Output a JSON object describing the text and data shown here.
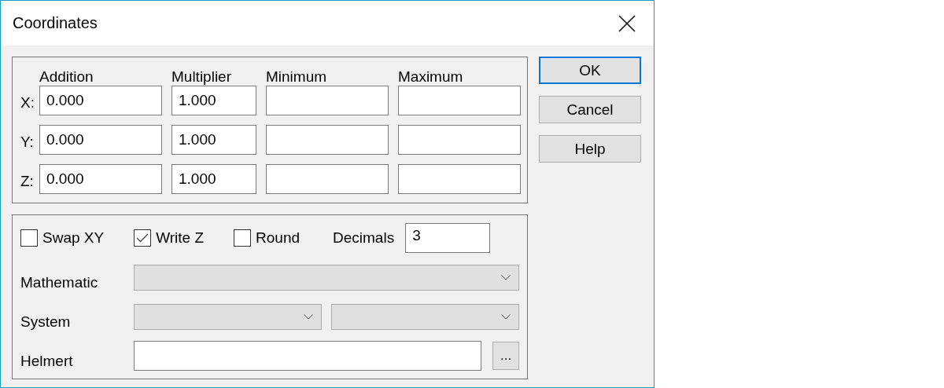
{
  "window": {
    "title": "Coordinates"
  },
  "coordinates": {
    "columns": [
      "Addition",
      "Multiplier",
      "Minimum",
      "Maximum"
    ],
    "rows": [
      {
        "label": "X:",
        "values": [
          "0.000",
          "1.000"
        ]
      },
      {
        "label": "Y:",
        "values": [
          "0.000",
          "1.000"
        ]
      },
      {
        "label": "Z:",
        "values": [
          "0.000",
          "1.000"
        ]
      }
    ]
  },
  "options": {
    "checkboxes": [
      {
        "label": "Swap XY",
        "checked": false
      },
      {
        "label": "Write Z",
        "checked": true
      },
      {
        "label": "Round",
        "checked": false
      }
    ],
    "decimals": {
      "label": "Decimals",
      "value": "3"
    },
    "mathematic": {
      "label": "Mathematic",
      "disabled": true
    },
    "system": {
      "label": "System",
      "disabled": true
    },
    "helmert": {
      "label": "Helmert",
      "browse": "..."
    }
  },
  "buttons": [
    {
      "label": "OK",
      "default": true
    },
    {
      "label": "Cancel",
      "default": false
    },
    {
      "label": "Help",
      "default": false
    }
  ]
}
